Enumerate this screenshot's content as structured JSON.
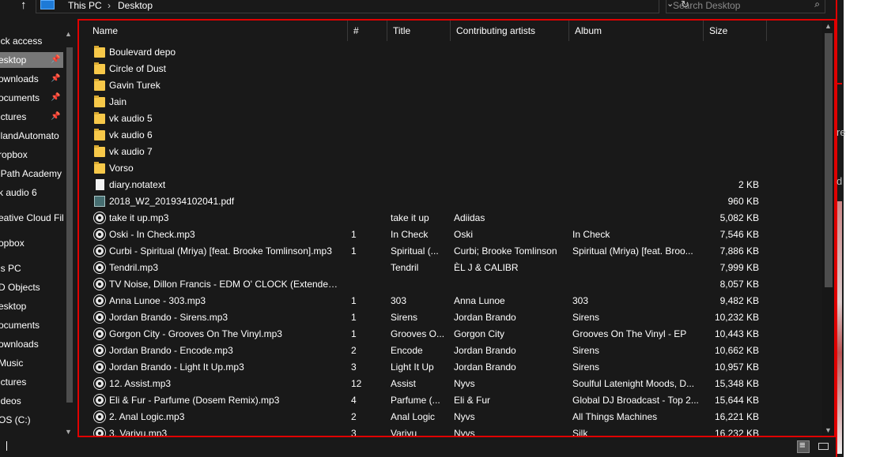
{
  "address_bar": {
    "breadcrumbs": [
      "This PC",
      "Desktop"
    ],
    "search_placeholder": "Search Desktop"
  },
  "nav": {
    "items": [
      {
        "label": "ick access",
        "pinned": false
      },
      {
        "label": "esktop",
        "pinned": true
      },
      {
        "label": "ownloads",
        "pinned": true
      },
      {
        "label": "ocuments",
        "pinned": true
      },
      {
        "label": "ictures",
        "pinned": true
      },
      {
        "label": "llandAutomato",
        "pinned": false
      },
      {
        "label": "ropbox",
        "pinned": false
      },
      {
        "label": "iPath Academy",
        "pinned": false
      },
      {
        "label": "k audio 6",
        "pinned": false
      },
      {
        "label": "eative Cloud Fil",
        "pinned": false
      },
      {
        "label": "opbox",
        "pinned": false
      },
      {
        "label": "is PC",
        "pinned": false
      },
      {
        "label": "D Objects",
        "pinned": false
      },
      {
        "label": "esktop",
        "pinned": false
      },
      {
        "label": "ocuments",
        "pinned": false
      },
      {
        "label": "ownloads",
        "pinned": false
      },
      {
        "label": "Music",
        "pinned": false
      },
      {
        "label": "ictures",
        "pinned": false
      },
      {
        "label": "ideos",
        "pinned": false
      },
      {
        "label": "OS (C:)",
        "pinned": false
      }
    ]
  },
  "columns": [
    "Name",
    "#",
    "Title",
    "Contributing artists",
    "Album",
    "Size"
  ],
  "files": [
    {
      "type": "folder",
      "name": "Boulevard depo",
      "num": "",
      "title": "",
      "artists": "",
      "album": "",
      "size": ""
    },
    {
      "type": "folder",
      "name": "Circle of Dust",
      "num": "",
      "title": "",
      "artists": "",
      "album": "",
      "size": ""
    },
    {
      "type": "folder",
      "name": "Gavin Turek",
      "num": "",
      "title": "",
      "artists": "",
      "album": "",
      "size": ""
    },
    {
      "type": "folder",
      "name": "Jain",
      "num": "",
      "title": "",
      "artists": "",
      "album": "",
      "size": ""
    },
    {
      "type": "folder",
      "name": "vk audio 5",
      "num": "",
      "title": "",
      "artists": "",
      "album": "",
      "size": ""
    },
    {
      "type": "folder",
      "name": "vk audio 6",
      "num": "",
      "title": "",
      "artists": "",
      "album": "",
      "size": ""
    },
    {
      "type": "folder",
      "name": "vk audio 7",
      "num": "",
      "title": "",
      "artists": "",
      "album": "",
      "size": ""
    },
    {
      "type": "folder",
      "name": "Vorso",
      "num": "",
      "title": "",
      "artists": "",
      "album": "",
      "size": ""
    },
    {
      "type": "doc",
      "name": "diary.notatext",
      "num": "",
      "title": "",
      "artists": "",
      "album": "",
      "size": "2 KB"
    },
    {
      "type": "pdf",
      "name": "2018_W2_201934102041.pdf",
      "num": "",
      "title": "",
      "artists": "",
      "album": "",
      "size": "960 KB"
    },
    {
      "type": "mp3",
      "name": "take it up.mp3",
      "num": "",
      "title": "take it up",
      "artists": "Adiidas",
      "album": "",
      "size": "5,082 KB"
    },
    {
      "type": "mp3",
      "name": "Oski - In Check.mp3",
      "num": "1",
      "title": "In Check",
      "artists": "Oski",
      "album": "In Check",
      "size": "7,546 KB"
    },
    {
      "type": "mp3",
      "name": "Curbi - Spiritual (Mriya) [feat. Brooke Tomlinson].mp3",
      "num": "1",
      "title": "Spiritual (...",
      "artists": "Curbi; Brooke Tomlinson",
      "album": "Spiritual (Mriya) [feat. Broo...",
      "size": "7,886 KB"
    },
    {
      "type": "mp3",
      "name": "Tendril.mp3",
      "num": "",
      "title": "Tendril",
      "artists": "ÈL J & CALIBR",
      "album": "",
      "size": "7,999 KB"
    },
    {
      "type": "mp3",
      "name": "TV Noise, Dillon Francis - EDM O' CLOCK (Extended ...",
      "num": "",
      "title": "",
      "artists": "",
      "album": "",
      "size": "8,057 KB"
    },
    {
      "type": "mp3",
      "name": "Anna Lunoe - 303.mp3",
      "num": "1",
      "title": "303",
      "artists": "Anna Lunoe",
      "album": "303",
      "size": "9,482 KB"
    },
    {
      "type": "mp3",
      "name": "Jordan Brando - Sirens.mp3",
      "num": "1",
      "title": "Sirens",
      "artists": "Jordan Brando",
      "album": "Sirens",
      "size": "10,232 KB"
    },
    {
      "type": "mp3",
      "name": "Gorgon City - Grooves On The Vinyl.mp3",
      "num": "1",
      "title": "Grooves O...",
      "artists": "Gorgon City",
      "album": "Grooves On The Vinyl - EP",
      "size": "10,443 KB"
    },
    {
      "type": "mp3",
      "name": "Jordan Brando - Encode.mp3",
      "num": "2",
      "title": "Encode",
      "artists": "Jordan Brando",
      "album": "Sirens",
      "size": "10,662 KB"
    },
    {
      "type": "mp3",
      "name": "Jordan Brando - Light It Up.mp3",
      "num": "3",
      "title": "Light It Up",
      "artists": "Jordan Brando",
      "album": "Sirens",
      "size": "10,957 KB"
    },
    {
      "type": "mp3",
      "name": "12. Assist.mp3",
      "num": "12",
      "title": "Assist",
      "artists": "Nyvs",
      "album": "Soulful Latenight Moods, D...",
      "size": "15,348 KB"
    },
    {
      "type": "mp3",
      "name": "Eli & Fur - Parfume (Dosem Remix).mp3",
      "num": "4",
      "title": "Parfume (...",
      "artists": "Eli & Fur",
      "album": "Global DJ Broadcast - Top 2...",
      "size": "15,644 KB"
    },
    {
      "type": "mp3",
      "name": "2. Anal Logic.mp3",
      "num": "2",
      "title": "Anal Logic",
      "artists": "Nyvs",
      "album": "All Things Machines",
      "size": "16,221 KB"
    },
    {
      "type": "mp3",
      "name": "3. Variyu.mp3",
      "num": "3",
      "title": "Variyu",
      "artists": "Nyvs",
      "album": "Silk",
      "size": "16,232 KB"
    }
  ],
  "background_window": {
    "fragments": [
      "re",
      "d"
    ]
  }
}
